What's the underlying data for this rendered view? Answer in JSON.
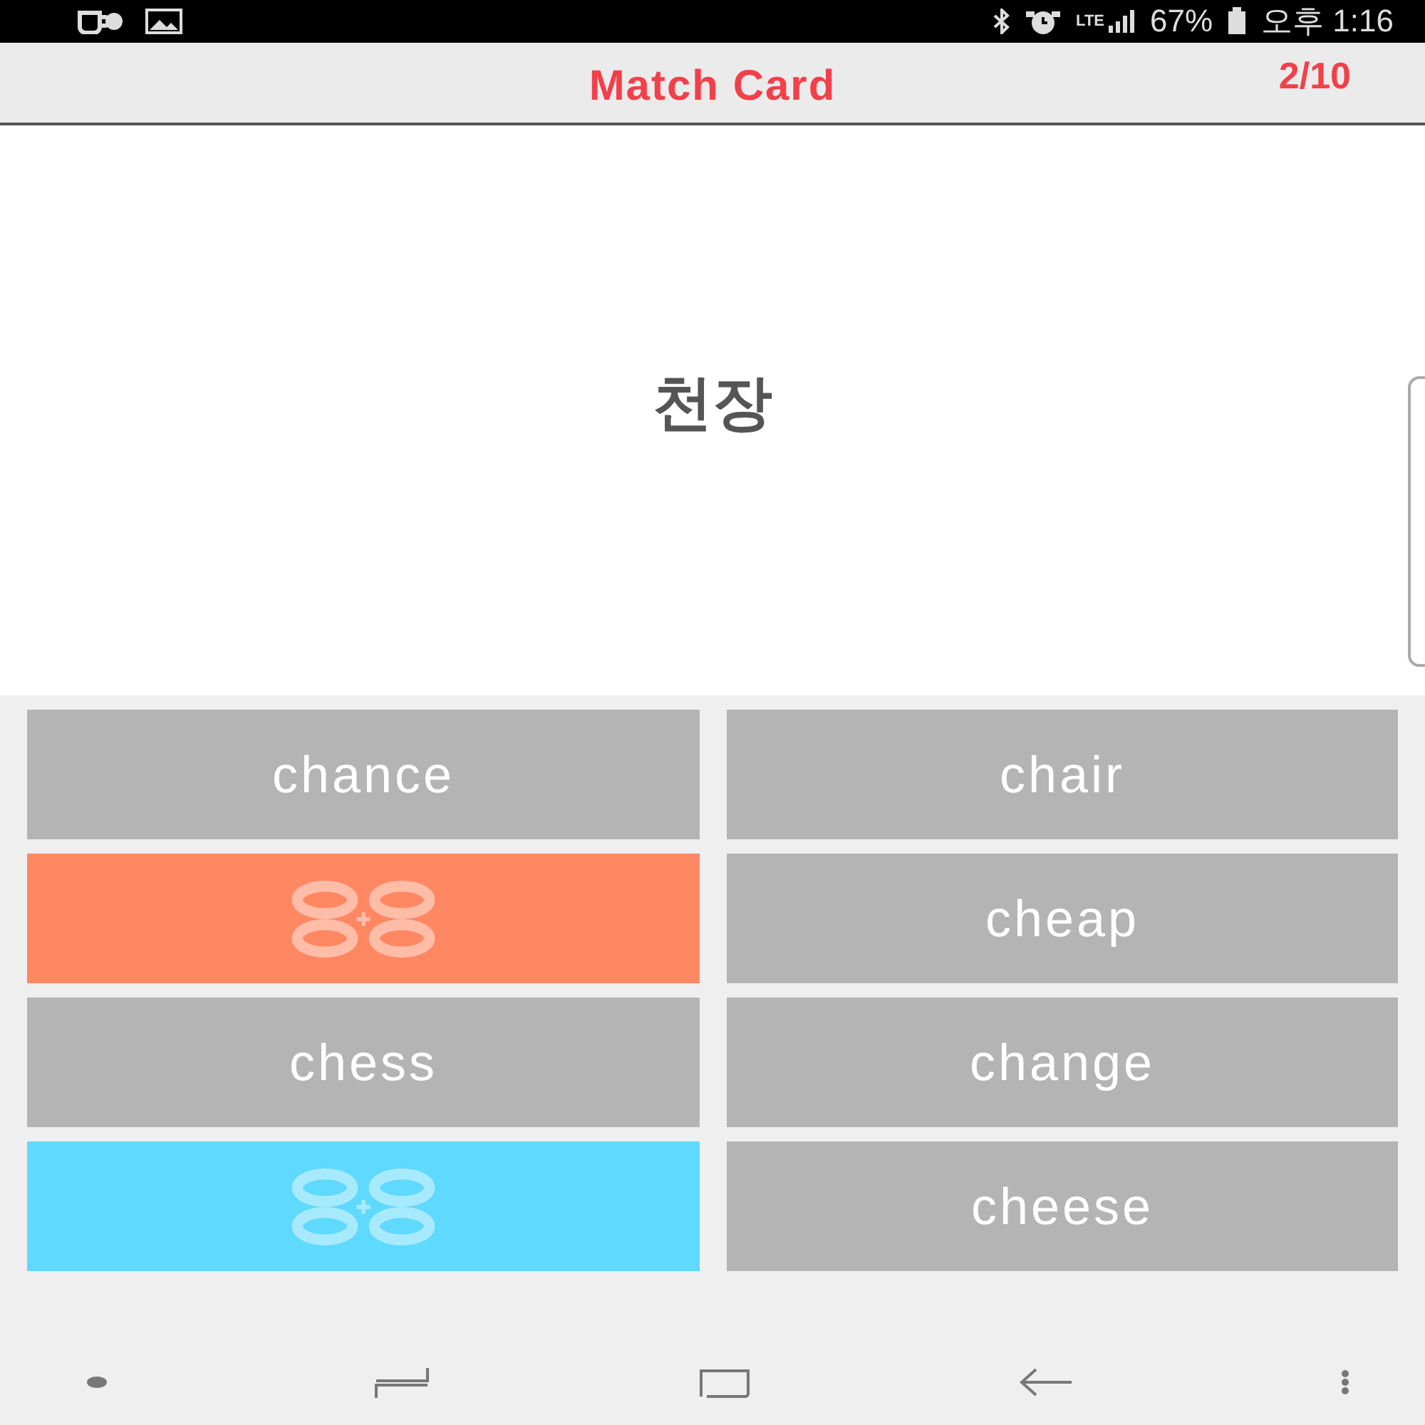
{
  "status_bar": {
    "network": "LTE",
    "battery": "67%",
    "time": "오후 1:16"
  },
  "header": {
    "title": "Match Card",
    "progress": "2/10"
  },
  "question": {
    "word": "천장"
  },
  "cards": [
    {
      "kind": "word",
      "text": "chance"
    },
    {
      "kind": "word",
      "text": "chair"
    },
    {
      "kind": "matched",
      "color": "#ff8762"
    },
    {
      "kind": "word",
      "text": "cheap"
    },
    {
      "kind": "word",
      "text": "chess"
    },
    {
      "kind": "word",
      "text": "change"
    },
    {
      "kind": "matched",
      "color": "#5fd9fd"
    },
    {
      "kind": "word",
      "text": "cheese"
    }
  ]
}
